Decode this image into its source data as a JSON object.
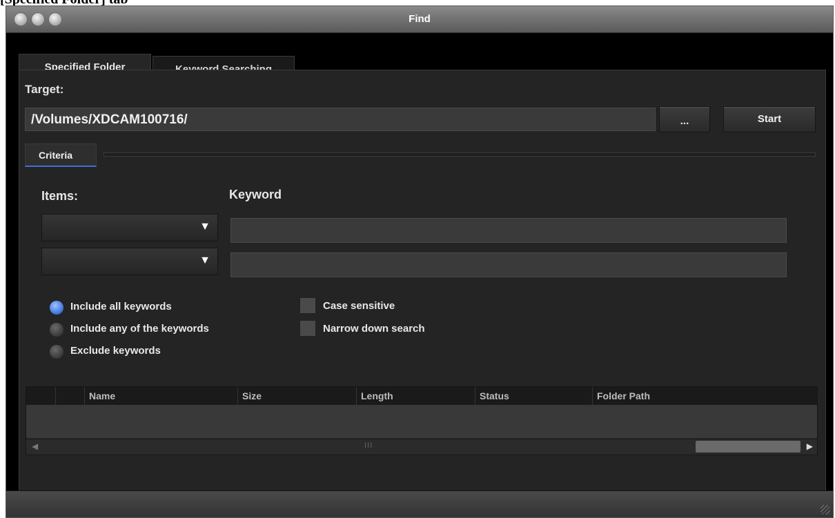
{
  "caption": "[Specified Folder] tab",
  "window": {
    "title": "Find"
  },
  "tabs": [
    {
      "label": "Specified Folder",
      "active": true
    },
    {
      "label": "Keyword Searching",
      "active": false
    }
  ],
  "target": {
    "label": "Target:",
    "value": "/Volumes/XDCAM100716/",
    "browse_label": "...",
    "start_label": "Start"
  },
  "criteria": {
    "tab_label": "Criteria",
    "items_label": "Items:",
    "keyword_label": "Keyword",
    "rows": [
      {
        "item": "",
        "keyword": ""
      },
      {
        "item": "",
        "keyword": ""
      }
    ],
    "radio_options": [
      {
        "label": "Include all keywords",
        "selected": true
      },
      {
        "label": "Include any of the keywords",
        "selected": false
      },
      {
        "label": "Exclude keywords",
        "selected": false
      }
    ],
    "checkboxes": [
      {
        "label": "Case sensitive",
        "checked": false
      },
      {
        "label": "Narrow down search",
        "checked": false
      }
    ]
  },
  "results": {
    "columns": [
      "",
      "",
      "Name",
      "Size",
      "Length",
      "Status",
      "Folder Path"
    ],
    "rows": [],
    "scroll_center_glyph": "III"
  },
  "colors": {
    "accent": "#3a72d8",
    "window_bg": "#242424"
  }
}
